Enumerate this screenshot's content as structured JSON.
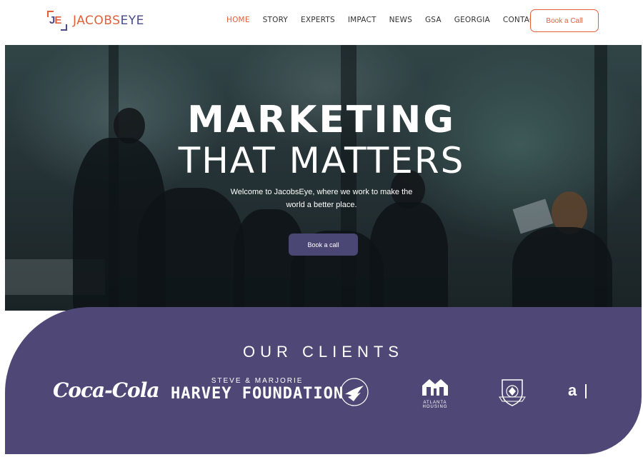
{
  "brand": {
    "initials_j": "J",
    "initials_e": "E",
    "name_part1": "JACOBS",
    "name_part2": "EYE",
    "accent_color": "#e2603a",
    "secondary_color": "#4b4a8a"
  },
  "nav": {
    "items": [
      {
        "label": "HOME",
        "active": true
      },
      {
        "label": "STORY",
        "active": false
      },
      {
        "label": "EXPERTS",
        "active": false
      },
      {
        "label": "IMPACT",
        "active": false
      },
      {
        "label": "NEWS",
        "active": false
      },
      {
        "label": "GSA",
        "active": false
      },
      {
        "label": "GEORGIA",
        "active": false
      },
      {
        "label": "CONTACT",
        "active": false
      }
    ],
    "cta_label": "Book a Call"
  },
  "hero": {
    "title_line1": "MARKETING",
    "title_line2": "THAT MATTERS",
    "subtitle_line1": "Welcome to JacobsEye, where we work to make the",
    "subtitle_line2": "world a better place.",
    "cta_label": "Book a call",
    "button_color": "#4b4775"
  },
  "clients": {
    "title": "OUR CLIENTS",
    "background_color": "#4f4876",
    "logos": {
      "coca_cola": "Coca-Cola",
      "harvey_line1": "STEVE & MARJORIE",
      "harvey_line2": "HARVEY FOUNDATION",
      "atlanta_line1": "ATLANTA",
      "atlanta_line2": "HOUSING",
      "partial": "a"
    }
  }
}
